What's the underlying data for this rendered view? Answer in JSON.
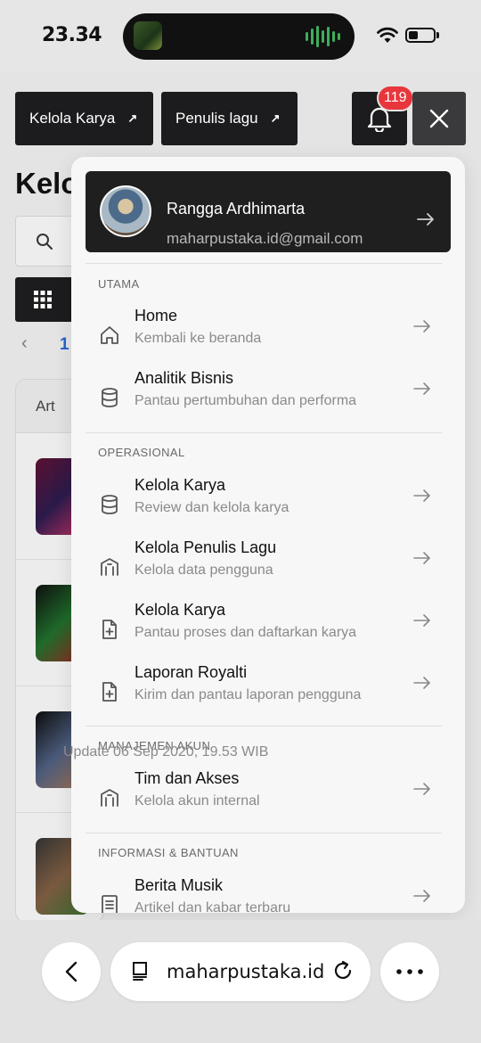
{
  "status": {
    "time": "23.34"
  },
  "toolbar": {
    "kelola_karya_label": "Kelola Karya",
    "penulis_lagu_label": "Penulis lagu",
    "notification_count": "119"
  },
  "page": {
    "title": "Kelola Karya",
    "pager_current": "1",
    "table_col_art": "Art"
  },
  "menu": {
    "profile": {
      "name": "Rangga Ardhimarta",
      "email": "maharpustaka.id@gmail.com"
    },
    "sections": {
      "utama": "UTAMA",
      "operasional": "OPERASIONAL",
      "manajemen": "MANAJEMEN AKUN",
      "informasi": "INFORMASI & BANTUAN"
    },
    "items": [
      {
        "title": "Home",
        "sub": "Kembali ke beranda",
        "icon": "home-icon"
      },
      {
        "title": "Analitik Bisnis",
        "sub": "Pantau pertumbuhan dan performa",
        "icon": "database-icon"
      },
      {
        "title": "Kelola Karya",
        "sub": "Review dan kelola karya",
        "icon": "database-icon"
      },
      {
        "title": "Kelola Penulis Lagu",
        "sub": "Kelola data pengguna",
        "icon": "building-icon"
      },
      {
        "title": "Kelola Karya",
        "sub": "Pantau proses dan daftarkan karya",
        "icon": "file-plus-icon"
      },
      {
        "title": "Laporan Royalti",
        "sub": "Kirim dan pantau laporan pengguna",
        "icon": "file-plus-icon"
      },
      {
        "title": "Tim dan Akses",
        "sub": "Kelola akun internal",
        "icon": "building-icon"
      },
      {
        "title": "Berita Musik",
        "sub": "Artikel dan kabar terbaru",
        "icon": "document-icon"
      }
    ],
    "peek_text": "Update 06 Sep 2020, 19.53 WIB"
  },
  "browser": {
    "url": "maharpustaka.id"
  },
  "colors": {
    "dark_button": "#1c1c1e",
    "badge": "#e8363c",
    "link_blue": "#2563c9",
    "menu_bg": "#f7f7f7"
  }
}
